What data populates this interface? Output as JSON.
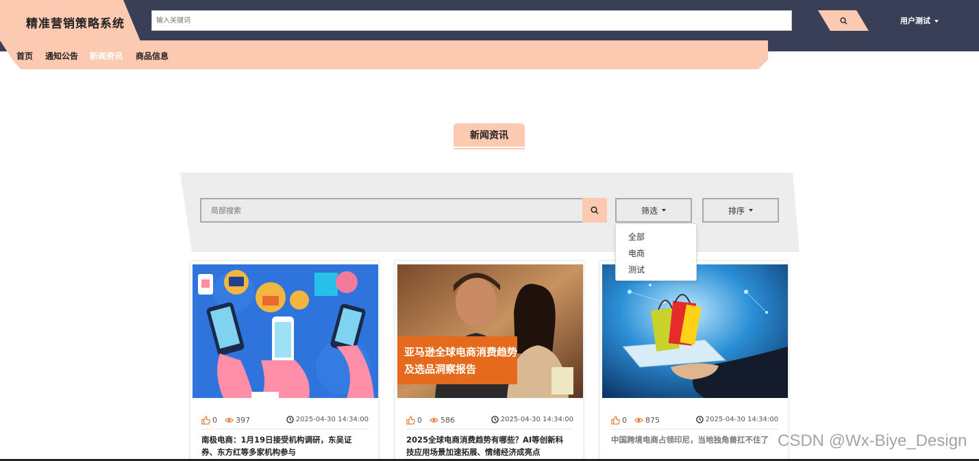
{
  "app": {
    "logo_text": "精准营销策略系统",
    "search_placeholder": "输入关键词",
    "user_label": "用户测试"
  },
  "nav": {
    "items": [
      {
        "label": "首页",
        "active": false
      },
      {
        "label": "通知公告",
        "active": false
      },
      {
        "label": "新闻资讯",
        "active": true
      },
      {
        "label": "商品信息",
        "active": false
      }
    ]
  },
  "section": {
    "title": "新闻资讯"
  },
  "filters": {
    "search_placeholder": "局部搜索",
    "filter_label": "筛选",
    "sort_label": "排序",
    "filter_options": [
      "全部",
      "电商",
      "测试"
    ]
  },
  "cards": [
    {
      "likes": "0",
      "views": "397",
      "time": "2025-04-30 14:34:00",
      "title": "南极电商：1月19日接受机构调研，东吴证券、东方红等多家机构参与",
      "image_overlay": ""
    },
    {
      "likes": "0",
      "views": "586",
      "time": "2025-04-30 14:34:00",
      "title": "2025全球电商消费趋势有哪些？AI等创新科技应用场景加速拓展、情绪经济成亮点",
      "image_overlay_line1": "亚马逊全球电商消费趋势",
      "image_overlay_line2": "及选品洞察报告"
    },
    {
      "likes": "0",
      "views": "875",
      "time": "2025-04-30 14:34:00",
      "title": "中国跨境电商占领印尼，当地独角兽扛不住了",
      "image_overlay": ""
    }
  ],
  "watermark": "CSDN @Wx-Biye_Design",
  "colors": {
    "header_bg": "#3a3f58",
    "accent": "#fccab0",
    "icon_orange": "#e8762c",
    "panel_bg": "#ededed"
  }
}
